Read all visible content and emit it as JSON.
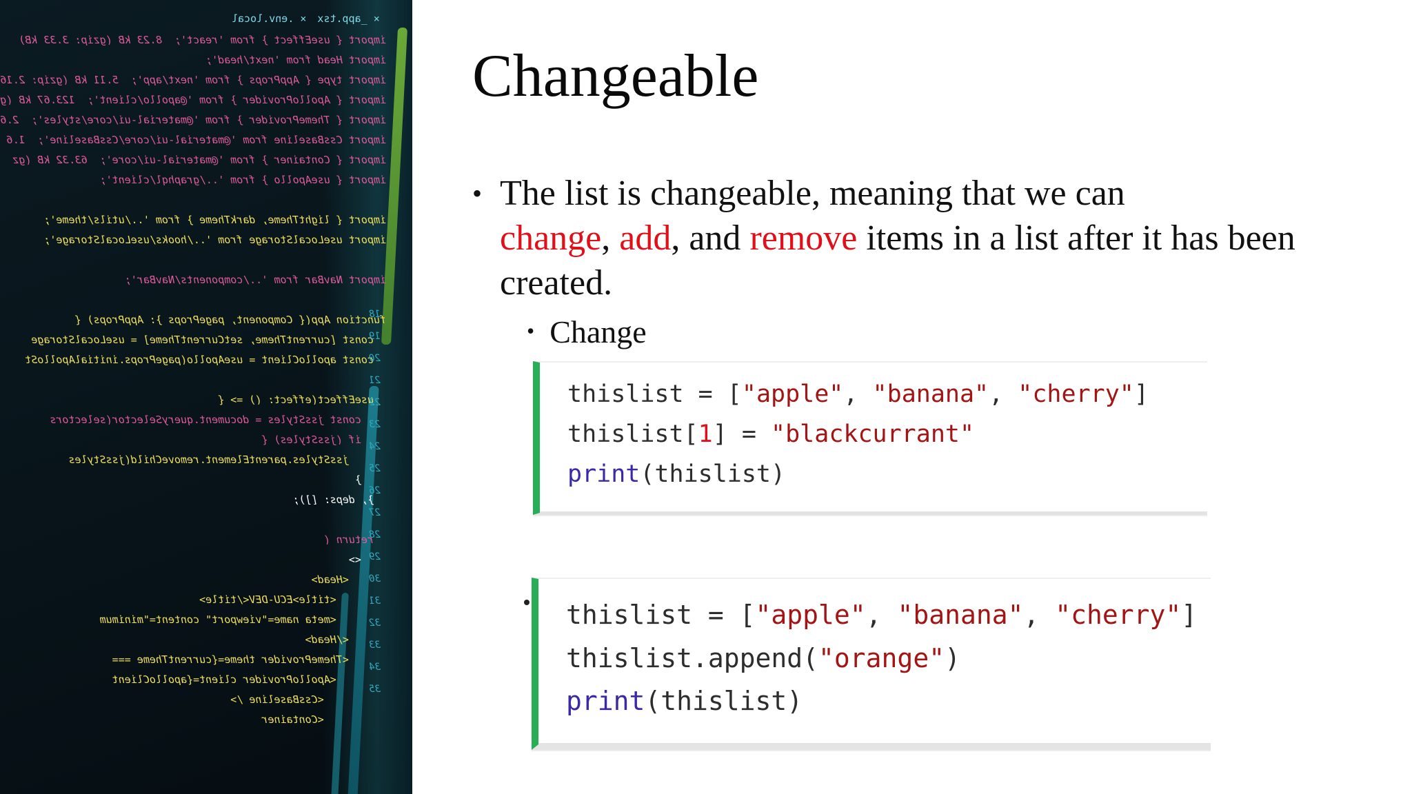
{
  "slide": {
    "title": "Changeable",
    "bullet": {
      "part1": "The list is changeable, meaning that we can",
      "change": "change",
      "comma1": ", ",
      "add": "add",
      "comma2": ", and ",
      "remove": "remove",
      "part2": " items in a list after it has been created."
    },
    "sub_bullet": "Change",
    "bullet_glyph": "•",
    "code_example_1": {
      "line1": [
        "thislist = [",
        "\"apple\"",
        ", ",
        "\"banana\"",
        ", ",
        "\"cherry\"",
        "]"
      ],
      "line2": [
        "thislist[",
        "1",
        "] = ",
        "\"blackcurrant\""
      ],
      "line3": [
        "print",
        "(thislist)"
      ]
    },
    "code_example_2": {
      "line1": [
        "thislist = [",
        "\"apple\"",
        ", ",
        "\"banana\"",
        ", ",
        "\"cherry\"",
        "]"
      ],
      "line2": [
        "thislist.append(",
        "\"orange\"",
        ")"
      ],
      "line3": [
        "print",
        "(thislist)"
      ]
    }
  },
  "image_panel": {
    "tabs": [
      "× _app.tsx",
      "× .env.local"
    ],
    "code_lines": [
      {
        "text": "import { useEffect } from 'react';  8.23 kB (gzip: 3.33 kB)",
        "color": "#e05a9d"
      },
      {
        "text": "import Head from 'next/head';",
        "color": "#e05a9d"
      },
      {
        "text": "import type { AppProps } from 'next/app';  5.11 kB (gzip: 2.16",
        "color": "#e05a9d"
      },
      {
        "text": "import { ApolloProvider } from '@apollo/client';  123.67 kB (g",
        "color": "#e05a9d"
      },
      {
        "text": "import { ThemeProvider } from '@material-ui/core/styles';  2.6",
        "color": "#e05a9d"
      },
      {
        "text": "import CssBaseline from '@material-ui/core/CssBaseline';  1.6",
        "color": "#e05a9d"
      },
      {
        "text": "import { Container } from '@material-ui/core';  63.32 kB (gz",
        "color": "#e05a9d"
      },
      {
        "text": "import { useApollo } from '../graphql/client';",
        "color": "#e05a9d"
      },
      {
        "text": "",
        "color": "#e05a9d"
      },
      {
        "text": "import { lightTheme, darkTheme } from '../utils/theme';",
        "color": "#f1e05a"
      },
      {
        "text": "import useLocalStorage from '../hooks/useLocalStorage';",
        "color": "#f1e05a"
      },
      {
        "text": "",
        "color": "#e05a9d"
      },
      {
        "text": "import NavBar from '../components/NavBar';",
        "color": "#e05a9d"
      },
      {
        "text": "",
        "color": "#e05a9d"
      },
      {
        "text": "function App({ Component, pageProps }: AppProps) {",
        "color": "#f1e05a"
      },
      {
        "text": "  const [currentTheme, setCurrentTheme] = useLocalStorage",
        "color": "#f1e05a"
      },
      {
        "text": "  const apolloClient = useApollo(pageProps.initialApolloSt",
        "color": "#f1e05a"
      },
      {
        "text": "",
        "color": "#e05a9d"
      },
      {
        "text": "  useEffect(effect: () => {",
        "color": "#f1e05a"
      },
      {
        "text": "    const jssStyles = document.querySelector(selectors",
        "color": "#e05a9d"
      },
      {
        "text": "    if (jssStyles) {",
        "color": "#e05a9d"
      },
      {
        "text": "      jssStyles.parentElement.removeChild(jssStyles",
        "color": "#f1e05a"
      },
      {
        "text": "    }",
        "color": "#ffffff"
      },
      {
        "text": "  }, deps: []);",
        "color": "#ffffff"
      },
      {
        "text": "",
        "color": "#e05a9d"
      },
      {
        "text": "  return (",
        "color": "#e05a9d"
      },
      {
        "text": "    <>",
        "color": "#ffffff"
      },
      {
        "text": "      <Head>",
        "color": "#f1e05a"
      },
      {
        "text": "        <title>ECU-DEV</title>",
        "color": "#f1e05a"
      },
      {
        "text": "        <meta name=\"viewport\" content=\"minimum",
        "color": "#f1e05a"
      },
      {
        "text": "      </Head>",
        "color": "#f1e05a"
      },
      {
        "text": "      <ThemeProvider theme={currentTheme ===",
        "color": "#f1e05a"
      },
      {
        "text": "        <ApolloProvider client={apolloClient",
        "color": "#f1e05a"
      },
      {
        "text": "          <CssBaseline />",
        "color": "#f1e05a"
      },
      {
        "text": "          <Container",
        "color": "#f1e05a"
      }
    ],
    "line_numbers": [
      "18",
      "19",
      "20",
      "21",
      "22",
      "23",
      "24",
      "25",
      "26",
      "27",
      "28",
      "29",
      "30",
      "31",
      "32",
      "33",
      "34",
      "35"
    ]
  }
}
